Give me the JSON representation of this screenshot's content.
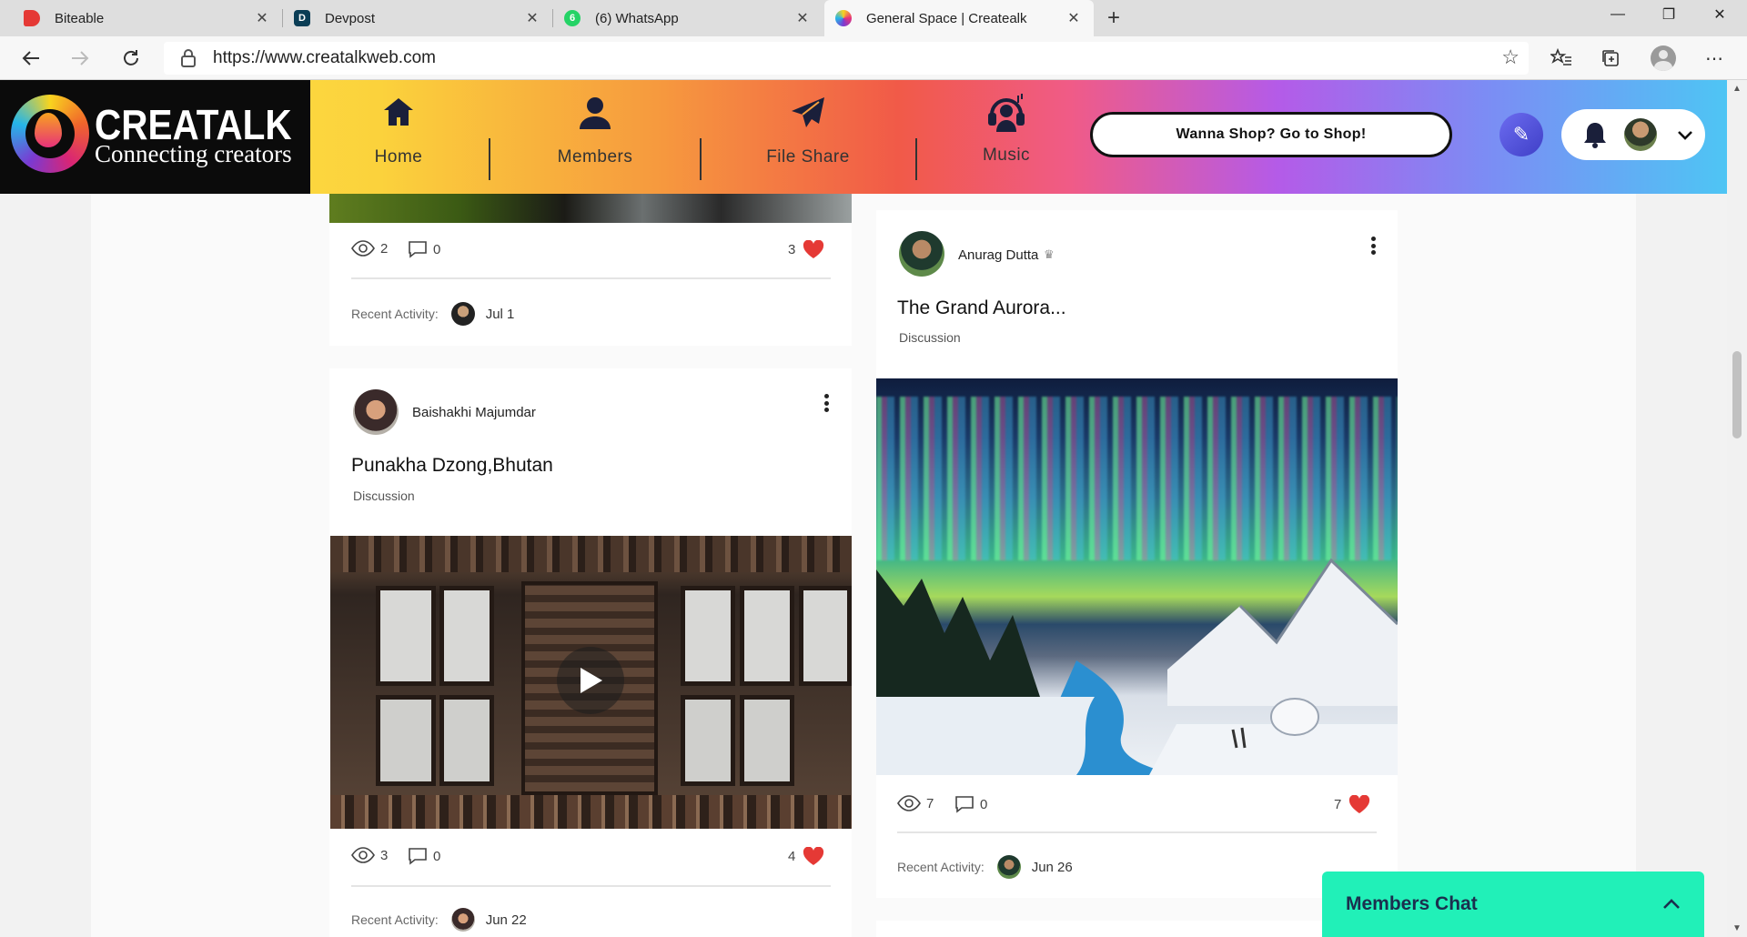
{
  "browser": {
    "tabs": [
      {
        "title": "Biteable",
        "favicon": "biteable-icon",
        "color": "#e53935"
      },
      {
        "title": "Devpost",
        "favicon": "devpost-icon",
        "color": "#003e54"
      },
      {
        "title": "(6) WhatsApp",
        "favicon": "whatsapp-icon",
        "color": "#25d366",
        "badge": "6"
      },
      {
        "title": "General Space | Createalk",
        "favicon": "createalk-icon",
        "color": "#111111",
        "active": true
      }
    ],
    "url": "https://www.creatalkweb.com"
  },
  "site": {
    "logo_title": "CREATALK",
    "logo_subtitle": "Connecting creators",
    "nav": [
      {
        "label": "Home",
        "icon": "home-icon"
      },
      {
        "label": "Members",
        "icon": "person-icon"
      },
      {
        "label": "File Share",
        "icon": "paper-plane-icon"
      },
      {
        "label": "Music",
        "icon": "headphones-icon"
      }
    ],
    "shop_button": "Wanna Shop? Go to Shop!",
    "colors": {
      "chat": "#21f0b8",
      "heart": "#e53935",
      "pencil": "#4b4bdc"
    }
  },
  "posts": {
    "top": {
      "views": "2",
      "comments": "0",
      "likes": "3",
      "recent_label": "Recent Activity:",
      "recent_date": "Jul 1"
    },
    "bhutan": {
      "author": "Baishakhi Majumdar",
      "title": "Punakha Dzong,Bhutan",
      "category": "Discussion",
      "views": "3",
      "comments": "0",
      "likes": "4",
      "recent_label": "Recent Activity:",
      "recent_date": "Jun 22"
    },
    "aurora": {
      "author": "Anurag Dutta",
      "title": "The Grand Aurora...",
      "category": "Discussion",
      "views": "7",
      "comments": "0",
      "likes": "7",
      "recent_label": "Recent Activity:",
      "recent_date": "Jun 26"
    }
  },
  "chat": {
    "label": "Members Chat"
  }
}
